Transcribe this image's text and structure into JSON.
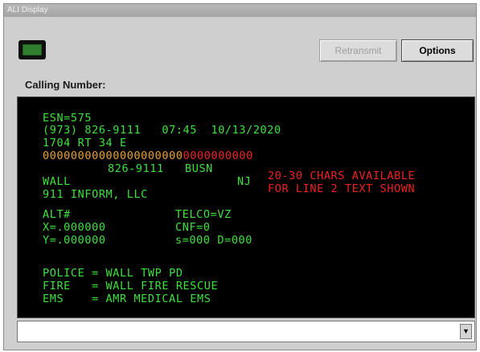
{
  "window": {
    "title": "ALI Display"
  },
  "buttons": {
    "retransmit": "Retransmit",
    "options": "Options"
  },
  "calling_label": "Calling Number:",
  "ali": {
    "esn": "ESN=575",
    "phone_line": "(973) 826-9111   07:45  10/13/2020",
    "address": "1704 RT 34 E",
    "zeros_orange": "00000000000000000000",
    "zeros_red": "0000000000",
    "callback_line": "826-9111   BUSN",
    "city": "WALL",
    "state": "NJ",
    "company": "911 INFORM, LLC",
    "alt": "ALT#",
    "telco": "TELCO=VZ",
    "x": "X=.000000",
    "cnf": "CNF=0",
    "y": "Y=.000000",
    "sd": "s=000 D=000",
    "police": "POLICE = WALL TWP PD",
    "fire": "FIRE   = WALL FIRE RESCUE",
    "ems": "EMS    = AMR MEDICAL EMS",
    "notice_1": "20-30 CHARS AVAILABLE",
    "notice_2": "FOR LINE 2 TEXT SHOWN"
  },
  "input": {
    "value": ""
  },
  "colors": {
    "text_green": "#3fe03f",
    "text_orange": "#e8a030",
    "text_red": "#ee2222",
    "screen_bg": "#000000"
  }
}
